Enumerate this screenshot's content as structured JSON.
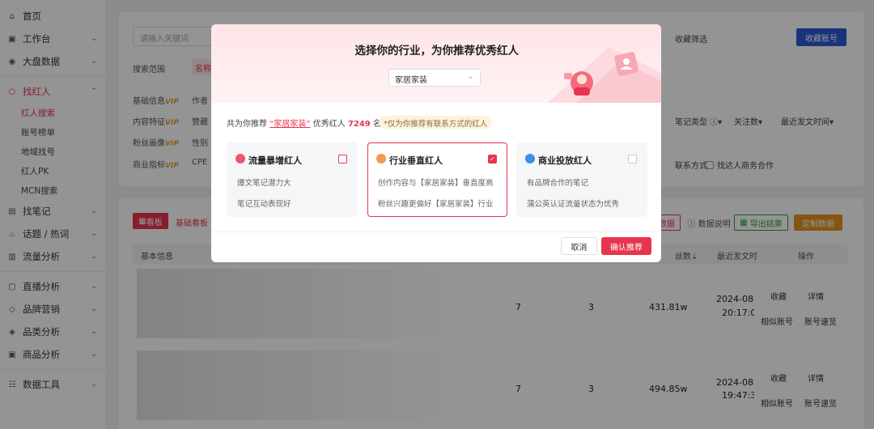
{
  "sidebar": {
    "items": [
      {
        "label": "首页"
      },
      {
        "label": "工作台"
      },
      {
        "label": "大盘数据"
      },
      {
        "label": "找红人"
      },
      {
        "label": "找笔记"
      },
      {
        "label": "话题 / 热词"
      },
      {
        "label": "流量分析"
      },
      {
        "label": "直播分析"
      },
      {
        "label": "品牌营销"
      },
      {
        "label": "品类分析"
      },
      {
        "label": "商品分析"
      },
      {
        "label": "数据工具"
      }
    ],
    "sub_items": [
      {
        "label": "红人搜索"
      },
      {
        "label": "账号榜单"
      },
      {
        "label": "地域找号"
      },
      {
        "label": "红人PK"
      },
      {
        "label": "MCN搜索"
      }
    ]
  },
  "filters": {
    "search_placeholder": "请输入关键词",
    "scope_label": "搜索范围",
    "scope_tag": "名称",
    "basic_info": "基础信息",
    "author": "作者",
    "content": "内容特征",
    "popularity": "赞藏",
    "fans": "粉丝画像",
    "gender": "性别",
    "business": "商业指标",
    "cpe": "CPE",
    "vip": "VIP",
    "collect_filter": "收藏筛选",
    "collect_btn": "收藏账号",
    "note_type": "笔记类型",
    "follow_count": "关注数",
    "recent_post": "最近发文时间",
    "contact": "联系方式",
    "business_coop": "找达人商务合作"
  },
  "table_area": {
    "tab_board": "看板",
    "tab_basic": "基础看板",
    "export_data": "数据",
    "data_explain": "数据说明",
    "export_result": "导出结果",
    "custom_data": "定制数据",
    "head_basic": "基本信息",
    "head_fans": "丝数",
    "head_recent": "最近发文时",
    "head_ops": "操作",
    "rows": [
      {
        "c1": "7",
        "c2": "3",
        "fans": "431.81w",
        "date": "2024-08-",
        "time": "20:17:03",
        "op_collect": "收藏",
        "op_detail": "详情",
        "op_similar": "相似账号",
        "op_speed": "账号速览"
      },
      {
        "c1": "7",
        "c2": "3",
        "fans": "494.85w",
        "date": "2024-08-",
        "time": "19:47:32",
        "op_collect": "收藏",
        "op_detail": "详情",
        "op_similar": "相似账号",
        "op_speed": "账号速览"
      }
    ]
  },
  "modal": {
    "title": "选择你的行业，为你推荐优秀红人",
    "select_value": "家居家装",
    "summary_prefix": "共为你推荐",
    "summary_keyword": "“家居家装”",
    "summary_mid": "优秀红人",
    "summary_count": "7249",
    "summary_suffix": "名",
    "note": "*仅为你推荐有联系方式的红人",
    "cards": [
      {
        "title": "流量暴增红人",
        "line1": "爆文笔记潜力大",
        "line2": "笔记互动表现好",
        "checked": false,
        "icon_color": "#f0566a"
      },
      {
        "title": "行业垂直红人",
        "line1": "创作内容与【家居家装】垂直度高",
        "line2": "粉丝兴趣更偏好【家居家装】行业",
        "checked": true,
        "icon_color": "#f2994a"
      },
      {
        "title": "商业投放红人",
        "line1": "有品牌合作的笔记",
        "line2": "蒲公英认证流量状态为优秀",
        "checked": false,
        "icon_color": "#3a8ee6"
      }
    ],
    "cancel_label": "取消",
    "confirm_label": "确认推荐"
  }
}
